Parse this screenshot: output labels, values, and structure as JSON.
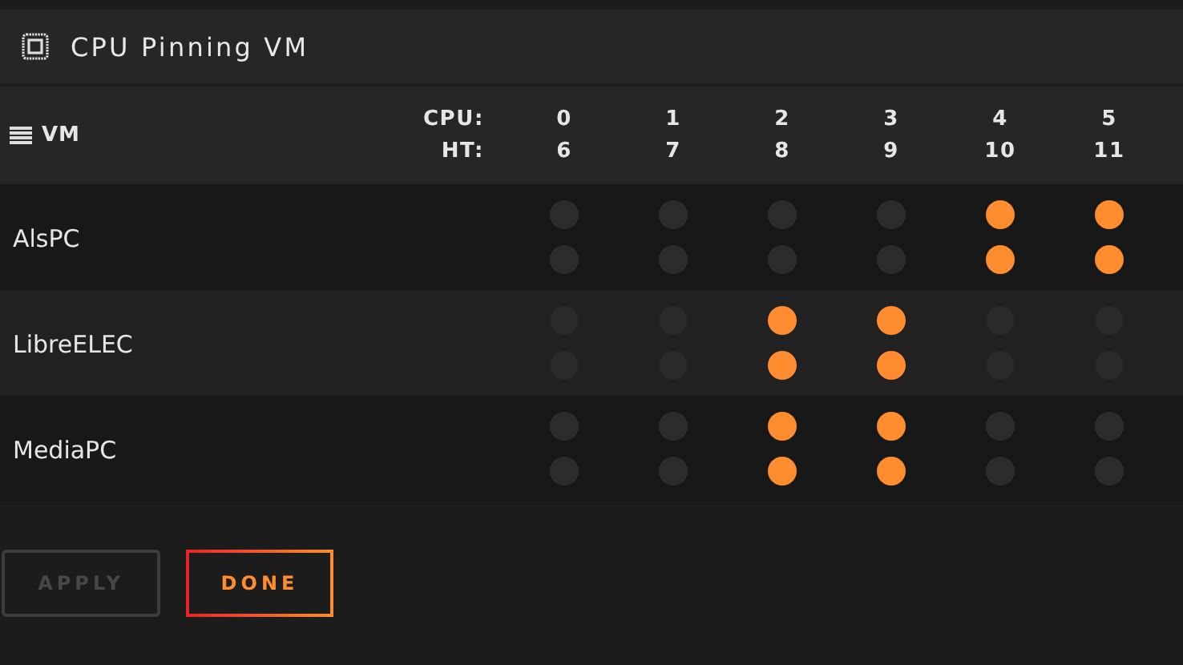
{
  "window": {
    "title": "CPU Pinning VM"
  },
  "header": {
    "vm_label": "VM",
    "cpu_label": "CPU:",
    "ht_label": "HT:"
  },
  "columns": [
    {
      "cpu": "0",
      "ht": "6"
    },
    {
      "cpu": "1",
      "ht": "7"
    },
    {
      "cpu": "2",
      "ht": "8"
    },
    {
      "cpu": "3",
      "ht": "9"
    },
    {
      "cpu": "4",
      "ht": "10"
    },
    {
      "cpu": "5",
      "ht": "11"
    }
  ],
  "rows": [
    {
      "name": "AlsPC",
      "pins": [
        {
          "cpu": false,
          "ht": false
        },
        {
          "cpu": false,
          "ht": false
        },
        {
          "cpu": false,
          "ht": false
        },
        {
          "cpu": false,
          "ht": false
        },
        {
          "cpu": true,
          "ht": true
        },
        {
          "cpu": true,
          "ht": true
        }
      ]
    },
    {
      "name": "LibreELEC",
      "pins": [
        {
          "cpu": false,
          "ht": false
        },
        {
          "cpu": false,
          "ht": false
        },
        {
          "cpu": true,
          "ht": true
        },
        {
          "cpu": true,
          "ht": true
        },
        {
          "cpu": false,
          "ht": false
        },
        {
          "cpu": false,
          "ht": false
        }
      ]
    },
    {
      "name": "MediaPC",
      "pins": [
        {
          "cpu": false,
          "ht": false
        },
        {
          "cpu": false,
          "ht": false
        },
        {
          "cpu": true,
          "ht": true
        },
        {
          "cpu": true,
          "ht": true
        },
        {
          "cpu": false,
          "ht": false
        },
        {
          "cpu": false,
          "ht": false
        }
      ]
    }
  ],
  "buttons": [
    {
      "label": "APPLY",
      "disabled": true
    },
    {
      "label": "DONE",
      "disabled": false
    }
  ]
}
